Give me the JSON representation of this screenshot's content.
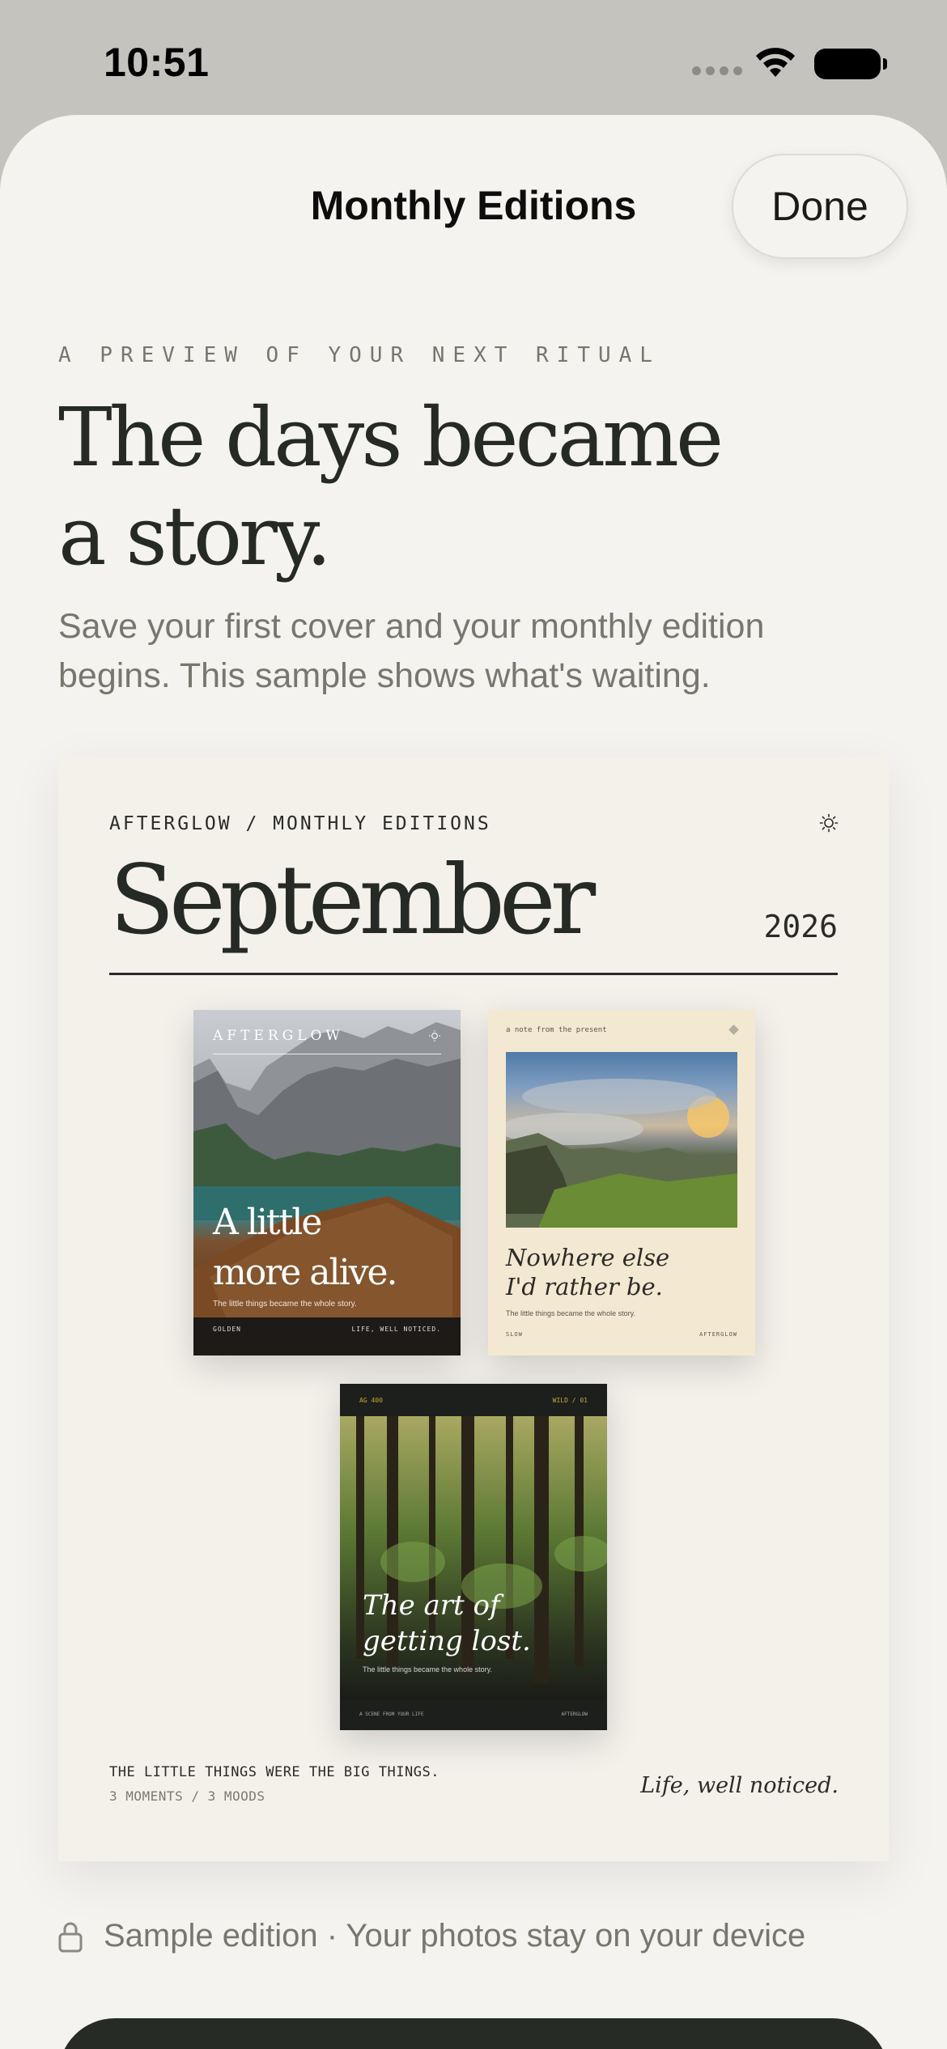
{
  "status_bar": {
    "time": "10:51"
  },
  "nav": {
    "title": "Monthly Editions",
    "done_label": "Done"
  },
  "intro": {
    "eyebrow": "A PREVIEW OF YOUR NEXT RITUAL",
    "headline_line1": "The days became",
    "headline_line2": "a story.",
    "subtitle": "Save your first cover and your monthly edition begins. This sample shows what's waiting."
  },
  "edition": {
    "eyebrow": "AFTERGLOW / MONTHLY EDITIONS",
    "month": "September",
    "year": "2026",
    "covers": [
      {
        "brand": "AFTERGLOW",
        "title_line1": "A little",
        "title_line2": "more alive.",
        "caption": "The little things became the whole story.",
        "footer_left": "GOLDEN",
        "footer_right": "LIFE, WELL NOTICED."
      },
      {
        "top_label": "a note from the present",
        "title_line1": "Nowhere else",
        "title_line2": "I'd rather be.",
        "caption": "The little things became the whole story.",
        "footer_left": "SLOW",
        "footer_right": "AFTERGLOW"
      },
      {
        "top_left": "AG 400",
        "top_right": "WILD / 01",
        "title_line1": "The art of",
        "title_line2": "getting lost.",
        "caption": "The little things became the whole story.",
        "footer_left": "A SCENE FROM YOUR LIFE",
        "footer_right": "AFTERGLOW"
      }
    ],
    "footer_line1": "THE LITTLE THINGS WERE THE BIG THINGS.",
    "footer_line2": "3 MOMENTS / 3 MOODS",
    "signature": "Life, well noticed."
  },
  "privacy_note": "Sample edition · Your photos stay on your device",
  "colors": {
    "background": "#f4f3ef",
    "ink": "#262a25",
    "muted": "#77776f",
    "cta": "#262b25"
  },
  "icons": [
    "wifi-icon",
    "battery-icon",
    "sun-icon",
    "lock-icon"
  ]
}
